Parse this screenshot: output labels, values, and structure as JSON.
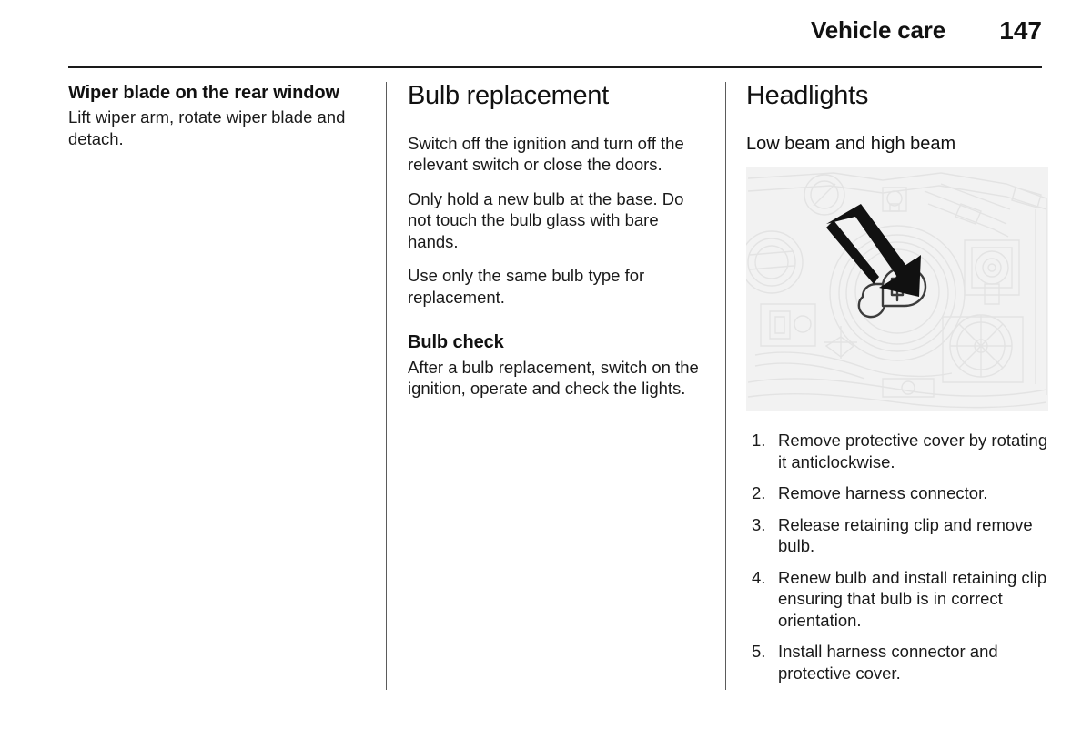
{
  "header": {
    "title": "Vehicle care",
    "page_number": "147"
  },
  "columns": {
    "left": {
      "heading": "Wiper blade on the rear window",
      "paragraphs": [
        "Lift wiper arm, rotate wiper blade and detach."
      ]
    },
    "middle": {
      "section_title": "Bulb replacement",
      "paragraphs": [
        "Switch off the ignition and turn off the relevant switch or close the doors.",
        "Only hold a new bulb at the base. Do not touch the bulb glass with bare hands.",
        "Use only the same bulb type for replacement."
      ],
      "subsection": {
        "heading": "Bulb check",
        "paragraphs": [
          "After a bulb replacement, switch on the ignition, operate and check the lights."
        ]
      }
    },
    "right": {
      "section_title": "Headlights",
      "subheading": "Low beam and high beam",
      "figure_label": "headlight-bulb-access-diagram",
      "steps": [
        "Remove protective cover by rotating it anticlockwise.",
        "Remove harness connector.",
        "Release retaining clip and remove bulb.",
        "Renew bulb and install retaining clip ensuring that bulb is in correct orientation.",
        "Install harness connector and protective cover."
      ]
    }
  },
  "colors": {
    "text": "#1a1a1a",
    "rule": "#1a1a1a",
    "divider": "#5b5b5b",
    "figure_background": "#f2f2f2",
    "figure_lines": "#e2e2e2",
    "arrow": "#111111"
  }
}
